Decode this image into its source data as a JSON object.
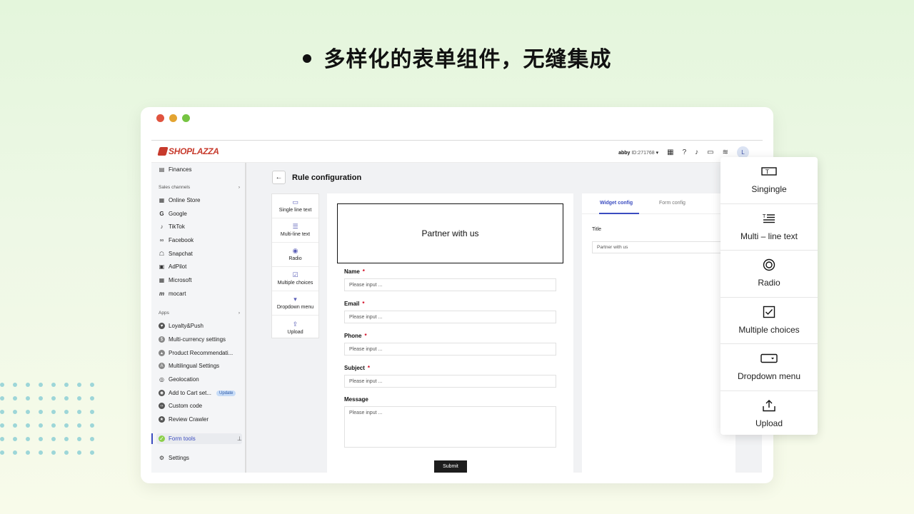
{
  "headline": "多样化的表单组件，无缝集成",
  "colors": {
    "brand": "#c73a2c",
    "accent": "#3b4cc0",
    "required": "#d0021b",
    "dot_pattern": "#9dd6d8"
  },
  "window": {
    "traffic_lights": [
      "#e0533f",
      "#e3a431",
      "#76c442"
    ]
  },
  "topbar": {
    "logo": "SHOPLAZZA",
    "user_name": "abby",
    "user_id": "ID:271768",
    "avatar_letter": "L",
    "icons": [
      "store-icon",
      "help-icon",
      "bell-icon",
      "chat-icon",
      "wifi-icon"
    ]
  },
  "sidebar": {
    "finances": "Finances",
    "sales_channels_label": "Sales channels",
    "channels": [
      "Online Store",
      "Google",
      "TikTok",
      "Facebook",
      "Snapchat",
      "AdPilot",
      "Microsoft",
      "mocart"
    ],
    "apps_label": "Apps",
    "apps": [
      "Loyalty&Push",
      "Multi-currency settings",
      "Product Recommendati...",
      "Multilingual Settings",
      "Geolocation",
      "Add to Cart set...",
      "Custom code",
      "Review Crawler"
    ],
    "update_badge": "Update",
    "form_tools": "Form tools",
    "settings": "Settings"
  },
  "main": {
    "title": "Rule configuration",
    "palette": [
      "Single line text",
      "Multi-line text",
      "Radio",
      "Multiple choices",
      "Dropdown menu",
      "Upload"
    ],
    "form": {
      "banner": "Partner with us",
      "fields": [
        {
          "label": "Name",
          "required": "*",
          "placeholder": "Please input ..."
        },
        {
          "label": "Email",
          "required": "*",
          "placeholder": "Please input ..."
        },
        {
          "label": "Phone",
          "required": "*",
          "placeholder": "Please input ..."
        },
        {
          "label": "Subject",
          "required": "*",
          "placeholder": "Please input ..."
        },
        {
          "label": "Message",
          "required": "",
          "placeholder": "Please input ..."
        }
      ],
      "submit": "Submit"
    },
    "config": {
      "tabs": [
        "Widget config",
        "Form config"
      ],
      "title_label": "Title",
      "title_value": "Partner with us"
    }
  },
  "popover": {
    "items": [
      "Singingle",
      "Multi – line text",
      "Radio",
      "Multiple choices",
      "Dropdown menu",
      "Upload"
    ]
  }
}
